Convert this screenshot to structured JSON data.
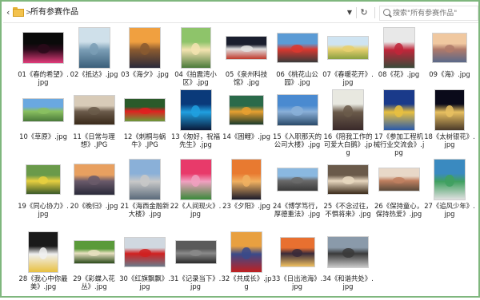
{
  "addressbar": {
    "back_icon": "chevron-left-icon",
    "separator": ">",
    "breadcrumb": "所有参赛作品",
    "dropdown_icon": "chevron-down-icon",
    "refresh_icon": "refresh-icon",
    "search_placeholder": "搜索\"所有参赛作品\""
  },
  "files": [
    {
      "name": "01《春的希望》.jpg",
      "colors": [
        "#0a0a0a",
        "#2a0a1a",
        "#e23c7a"
      ]
    },
    {
      "name": "02《抵达》.jpg",
      "colors": [
        "#cfe0ea",
        "#7a9db5",
        "#3b5f7a"
      ]
    },
    {
      "name": "03《海夕》.jpg",
      "colors": [
        "#f0a040",
        "#8a5a30",
        "#2a2a3a"
      ]
    },
    {
      "name": "04《拍震湾小区》.jpg",
      "colors": [
        "#8ec46a",
        "#f3e3b0",
        "#4a7a3a"
      ]
    },
    {
      "name": "05《泉州科技馆》.jpg",
      "colors": [
        "#1a1e2e",
        "#e0e0e0",
        "#c0392b"
      ]
    },
    {
      "name": "06《桃花山公园》.jpg",
      "colors": [
        "#5b9bd5",
        "#d9382f",
        "#3a3a3a"
      ]
    },
    {
      "name": "07《春暖花开》.jpg",
      "colors": [
        "#cfe4f2",
        "#e8d070",
        "#8aa040"
      ]
    },
    {
      "name": "08《花》.jpg",
      "colors": [
        "#e8e8e8",
        "#c0263a",
        "#3a4a3a"
      ]
    },
    {
      "name": "09《海》.jpg",
      "colors": [
        "#f0c8a0",
        "#b07a6a",
        "#5a6a8a"
      ]
    },
    {
      "name": "10《草原》.jpg",
      "colors": [
        "#6aa8e0",
        "#8ac060",
        "#4a7a3a"
      ]
    },
    {
      "name": "11《日常与理想》.JPG",
      "colors": [
        "#d8cbb8",
        "#6a5a4a",
        "#3a2a1a"
      ]
    },
    {
      "name": "12《刺桐与蜗牛》.JPG",
      "colors": [
        "#2a5a2a",
        "#e02020",
        "#6a9a3a"
      ]
    },
    {
      "name": "13《匆好，祝福先生》.jpg",
      "colors": [
        "#0a3a7a",
        "#20a0e0",
        "#0a1a3a"
      ]
    },
    {
      "name": "14《困鲤》.jpg",
      "colors": [
        "#2a6a4a",
        "#e8a030",
        "#1a3a2a"
      ]
    },
    {
      "name": "15《入职那天的公司大楼》.jpg",
      "colors": [
        "#4a8ad0",
        "#8ab0d8",
        "#2a4a6a"
      ]
    },
    {
      "name": "16《陪我工作的可爱大白鹅》.jpg",
      "colors": [
        "#e8e8e0",
        "#6a5a4a",
        "#3a2a2a"
      ]
    },
    {
      "name": "17《参加工程机械行业交流会》.jpg",
      "colors": [
        "#1a3a8a",
        "#e8c040",
        "#2a5aaa"
      ]
    },
    {
      "name": "18《太树银花》.jpg",
      "colors": [
        "#0a0a1a",
        "#e8c060",
        "#4a3a2a"
      ]
    },
    {
      "name": "19《同心协力》.jpg",
      "colors": [
        "#6a9a4a",
        "#e8d040",
        "#3a5a2a"
      ]
    },
    {
      "name": "20《晚归》.jpg",
      "colors": [
        "#e8a060",
        "#6a5a6a",
        "#2a2a3a"
      ]
    },
    {
      "name": "21《海西金融新大楼》.jpg",
      "colors": [
        "#8ab0d8",
        "#c8c8c8",
        "#5a6a7a"
      ]
    },
    {
      "name": "22《人间现火》.jpg",
      "colors": [
        "#e83a6a",
        "#f0a0c0",
        "#3a8a3a"
      ]
    },
    {
      "name": "23《夕阳》.jpg",
      "colors": [
        "#e87a30",
        "#f0b060",
        "#1a1a2a"
      ]
    },
    {
      "name": "24《博学笃行，厚德重法》.jpg",
      "colors": [
        "#8ab8e0",
        "#6a6a6a",
        "#3a3a3a"
      ]
    },
    {
      "name": "25《不念过往，不惧将来》.jpg",
      "colors": [
        "#6a5a4a",
        "#e8d8c0",
        "#3a2a1a"
      ]
    },
    {
      "name": "26《保持童心，保持热爱》.jpg",
      "colors": [
        "#e8d8c8",
        "#c08060",
        "#5a4a3a"
      ]
    },
    {
      "name": "27《追风少年》.jpg",
      "colors": [
        "#3a8ac0",
        "#40a060",
        "#e0e0e0"
      ]
    },
    {
      "name": "28《我心中你最美》.jpg",
      "colors": [
        "#1a1a1a",
        "#f0f0f0",
        "#e8c040"
      ]
    },
    {
      "name": "29《彩蝶入花丛》.jpg",
      "colors": [
        "#5a9a3a",
        "#e8e0c0",
        "#2a4a1a"
      ]
    },
    {
      "name": "30《红旗飘飘》.jpg",
      "colors": [
        "#d0d8e0",
        "#d02020",
        "#6a7a8a"
      ]
    },
    {
      "name": "31《记录当下》.jpg",
      "colors": [
        "#5a5a5a",
        "#8a8a8a",
        "#2a2a2a"
      ]
    },
    {
      "name": "32《共成长》.jpg",
      "colors": [
        "#e8a040",
        "#3a4a8a",
        "#c02020"
      ]
    },
    {
      "name": "33《日出池海》.jpg",
      "colors": [
        "#e87030",
        "#3a2a3a",
        "#f0c060"
      ]
    },
    {
      "name": "34《和谐共处》.jpg",
      "colors": [
        "#8a9aaa",
        "#3a3a3a",
        "#c8c8c8"
      ]
    }
  ]
}
